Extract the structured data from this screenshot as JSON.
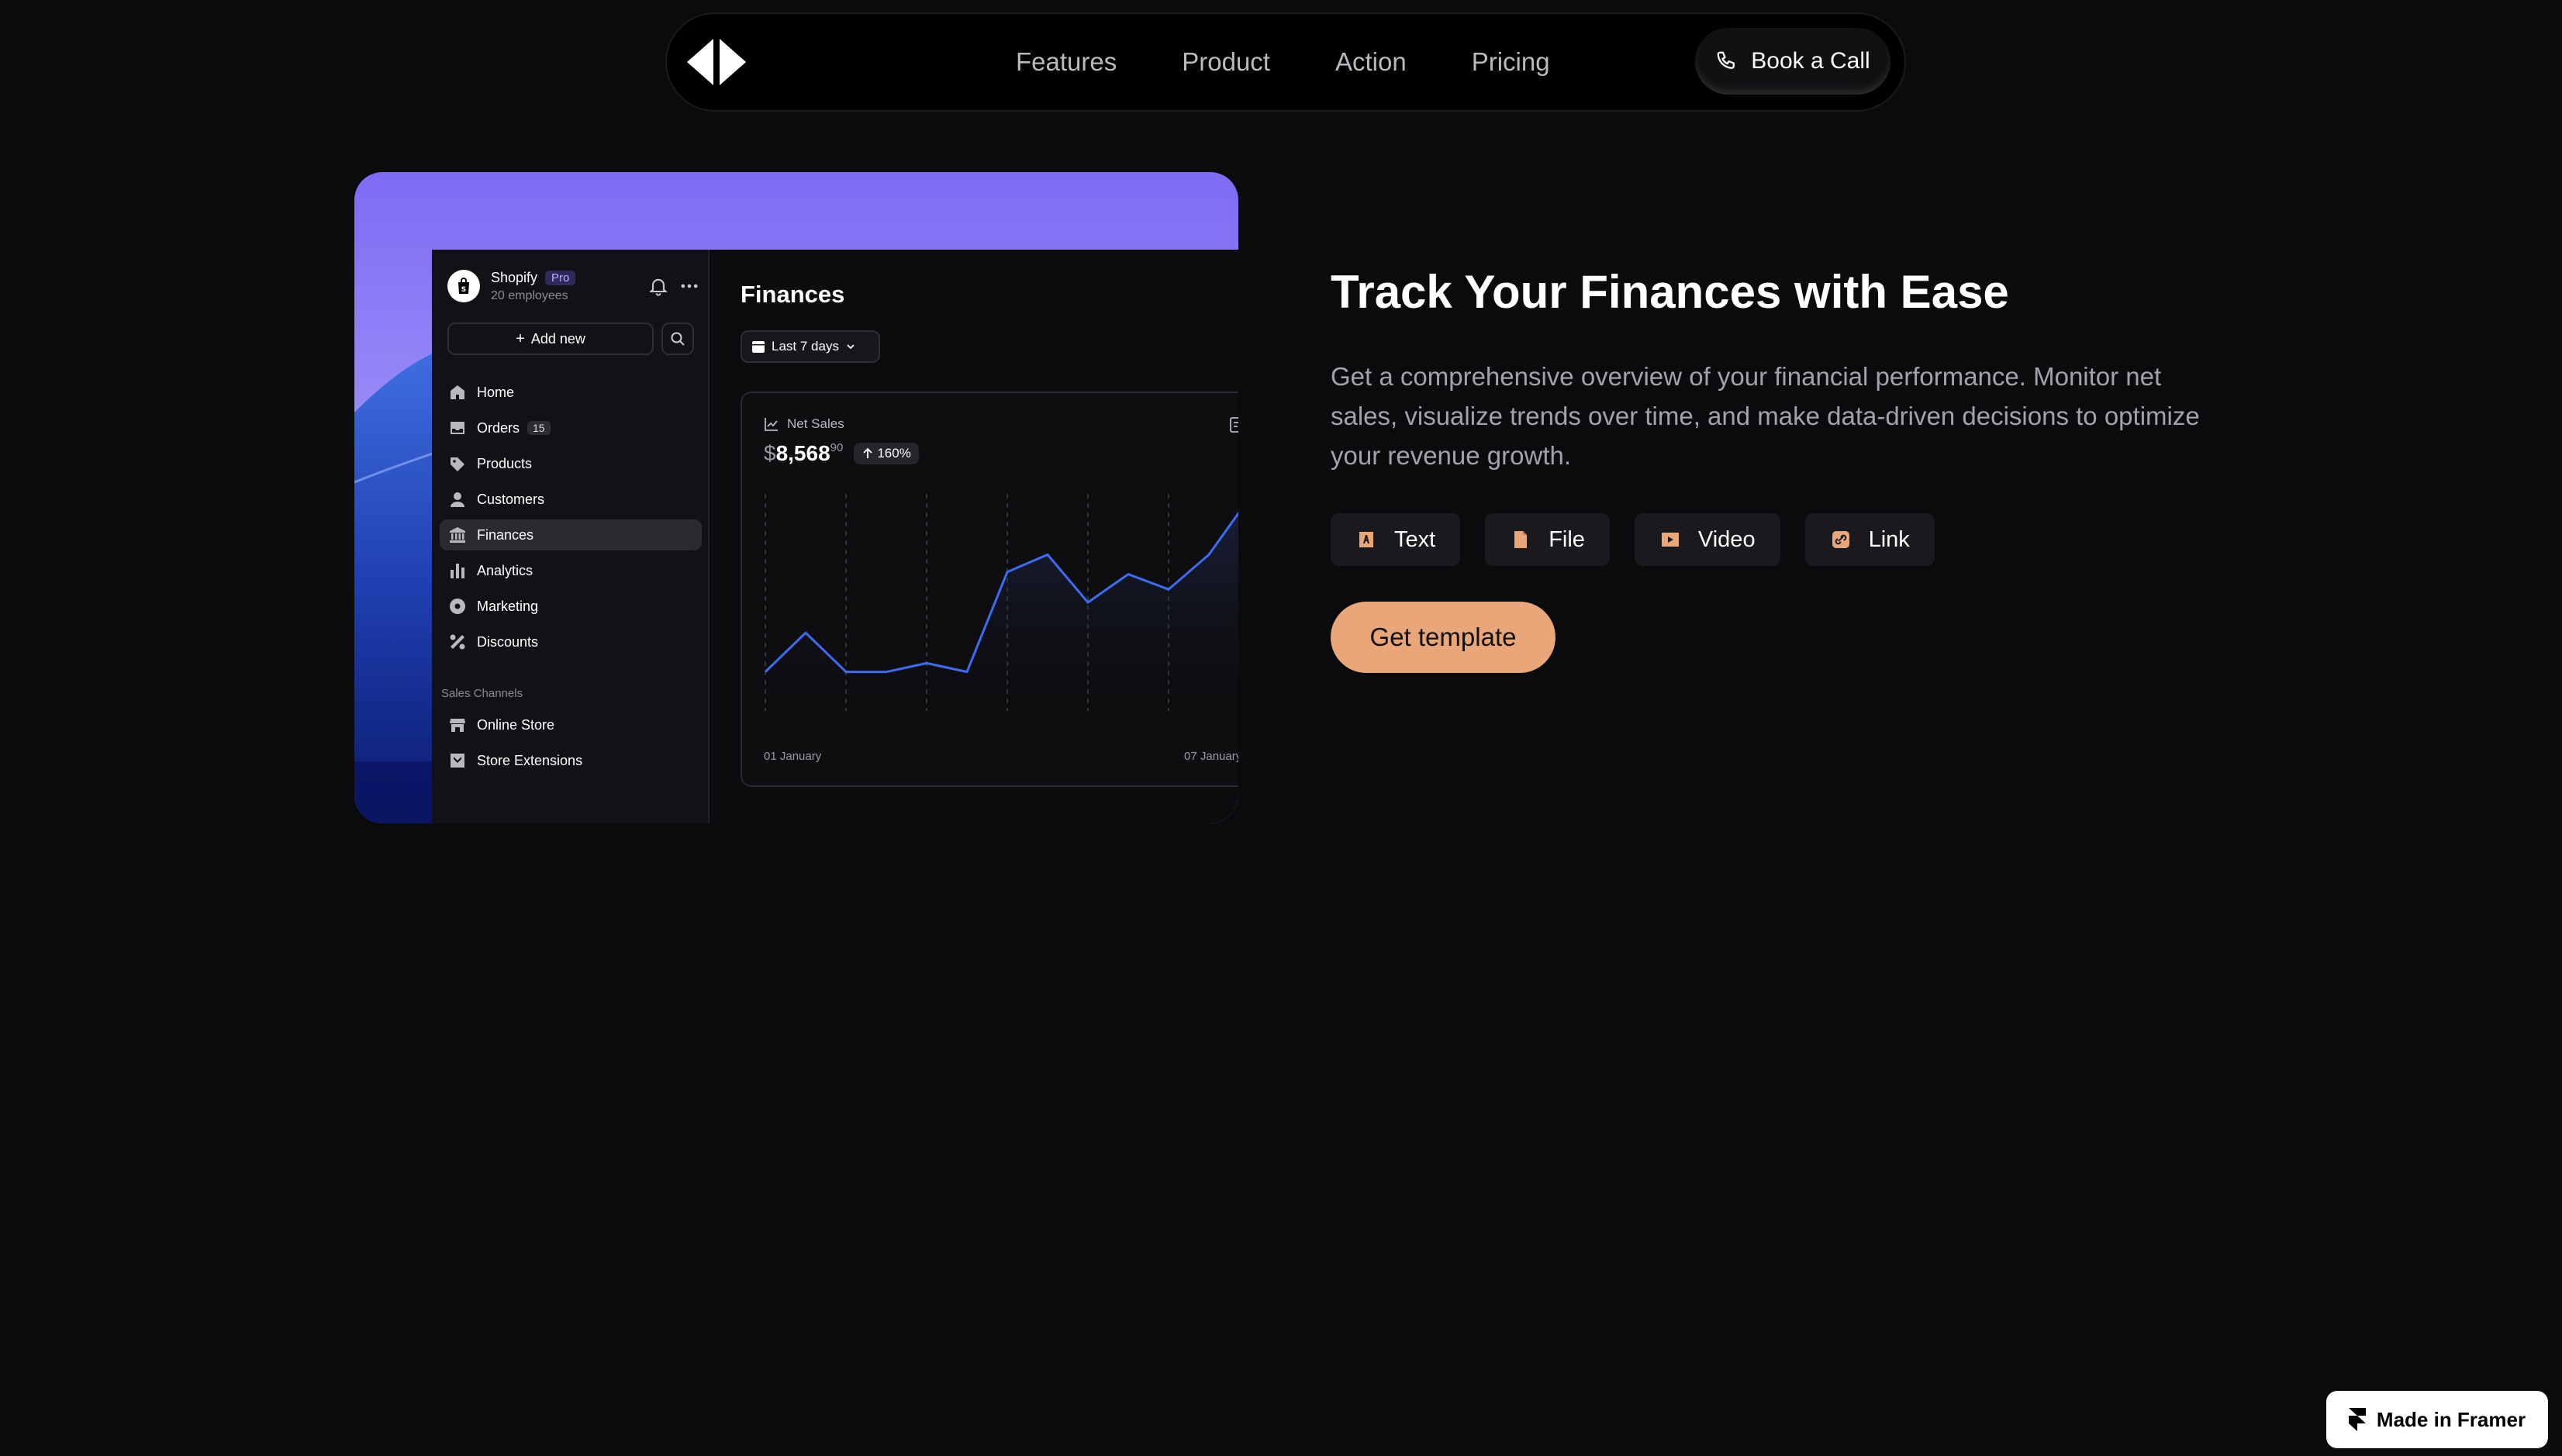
{
  "nav": {
    "links": [
      "Features",
      "Product",
      "Action",
      "Pricing"
    ],
    "call_label": "Book a Call",
    "logo_icon": "diamond-split-logo",
    "phone_icon": "phone-icon"
  },
  "mock": {
    "store": {
      "name": "Shopify",
      "badge": "Pro",
      "sub": "20 employees"
    },
    "add_label": "Add new",
    "sidebar": [
      {
        "label": "Home",
        "icon": "home-icon"
      },
      {
        "label": "Orders",
        "icon": "inbox-icon",
        "count": "15"
      },
      {
        "label": "Products",
        "icon": "tag-icon"
      },
      {
        "label": "Customers",
        "icon": "person-icon"
      },
      {
        "label": "Finances",
        "icon": "bank-icon",
        "active": true
      },
      {
        "label": "Analytics",
        "icon": "bar-chart-icon"
      },
      {
        "label": "Marketing",
        "icon": "target-icon"
      },
      {
        "label": "Discounts",
        "icon": "percent-icon"
      }
    ],
    "channels_label": "Sales Channels",
    "channels": [
      {
        "label": "Online Store",
        "icon": "store-icon"
      },
      {
        "label": "Store Extensions",
        "icon": "extension-icon"
      }
    ],
    "title": "Finances",
    "date_range": "Last 7 days",
    "card": {
      "label": "Net Sales",
      "currency": "$",
      "amount": "8,568",
      "cents": "90",
      "growth": "160%",
      "x_first": "01 January",
      "x_last": "07 January"
    }
  },
  "chart_data": {
    "type": "line",
    "title": "",
    "xlabel": "",
    "ylabel": "",
    "x_ticks_shown": [
      "01 January",
      "07 January"
    ],
    "values": [
      18,
      36,
      18,
      18,
      22,
      18,
      64,
      72,
      50,
      63,
      56,
      72,
      98
    ],
    "ylim": [
      0,
      100
    ],
    "color": "#3d6cf2",
    "grid": "vertical-dashed"
  },
  "hero": {
    "headline": "Track Your Finances with Ease",
    "description": "Get a comprehensive overview of your financial performance. Monitor net sales, visualize trends over time, and make data-driven decisions to optimize your revenue growth.",
    "chips": [
      {
        "label": "Text",
        "icon": "text-icon"
      },
      {
        "label": "File",
        "icon": "file-icon"
      },
      {
        "label": "Video",
        "icon": "video-icon"
      },
      {
        "label": "Link",
        "icon": "link-icon"
      }
    ],
    "cta": "Get template",
    "accent": "#e8a679"
  },
  "badge": {
    "label": "Made in Framer",
    "icon": "framer-icon"
  }
}
